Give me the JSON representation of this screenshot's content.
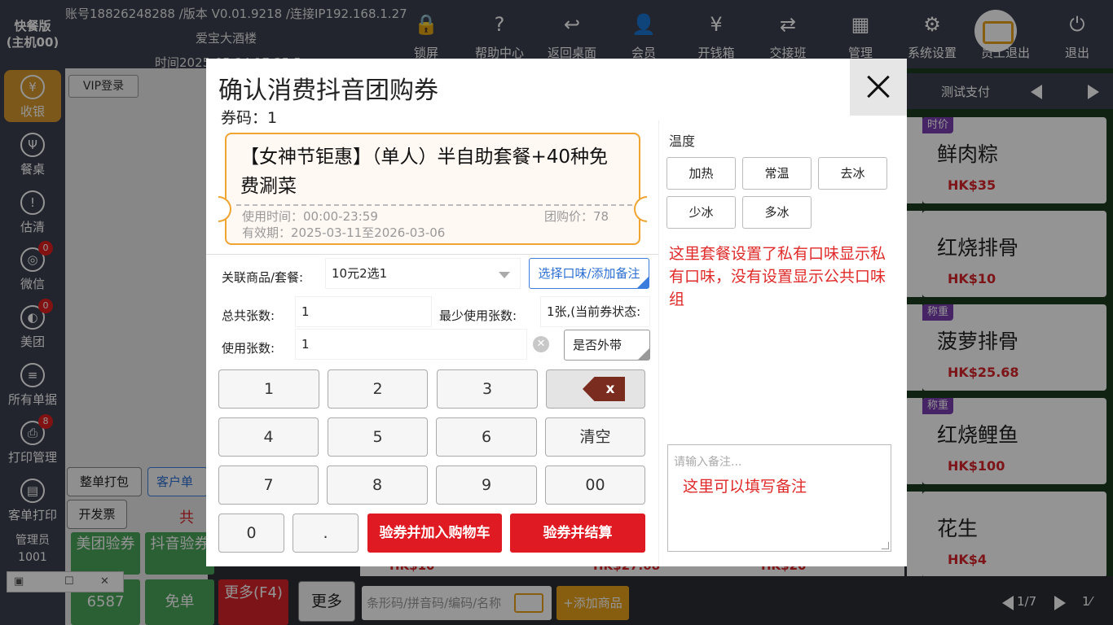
{
  "app": {
    "edition_line1": "快餐版",
    "edition_line2": "(主机00)",
    "account_info": "账号18826248288 /版本 V0.01.9218 /连接IP192.168.1.27",
    "restaurant": "爱宝大酒楼",
    "time_text": "时间2025-05-24 17:35:51"
  },
  "topbar": [
    {
      "label": "锁屏",
      "icon": "🔒"
    },
    {
      "label": "帮助中心",
      "icon": "?"
    },
    {
      "label": "返回桌面",
      "icon": "↩"
    },
    {
      "label": "会员",
      "icon": "👤"
    },
    {
      "label": "开钱箱",
      "icon": "¥"
    },
    {
      "label": "交接班",
      "icon": "⇄"
    },
    {
      "label": "管理",
      "icon": "▦"
    },
    {
      "label": "系统设置",
      "icon": "⚙"
    },
    {
      "label": "员工退出",
      "icon": ""
    },
    {
      "label": "退出",
      "icon": "⏻"
    }
  ],
  "sidebar": [
    {
      "label": "收银",
      "icon": "¥",
      "badge": ""
    },
    {
      "label": "餐桌",
      "icon": "Ψ",
      "badge": ""
    },
    {
      "label": "估清",
      "icon": "!",
      "badge": ""
    },
    {
      "label": "微信",
      "icon": "◎",
      "badge": "0"
    },
    {
      "label": "美团",
      "icon": "◐",
      "badge": "0"
    },
    {
      "label": "所有单据",
      "icon": "≡",
      "badge": ""
    },
    {
      "label": "打印管理",
      "icon": "⎙",
      "badge": "8"
    },
    {
      "label": "客单打印",
      "icon": "▤",
      "badge": ""
    }
  ],
  "admin": {
    "role": "管理员",
    "id": "1001"
  },
  "order_panel": {
    "vip_login": "VIP登录",
    "pack_all": "整单打包",
    "customer_order": "客户单",
    "invoice": "开发票",
    "total_prefix": "共",
    "meituan_verify": "美团验券",
    "douyin_verify": "抖音验券",
    "amount": "6587",
    "free_order": "免单",
    "more_f4": "更多(F4)",
    "more": "更多"
  },
  "right_panel": {
    "pay_label": "测试支付",
    "dishes": [
      {
        "tag": "时价",
        "name": "鲜肉粽",
        "price": "HK$35"
      },
      {
        "tag": "",
        "name": "红烧排骨",
        "price": "HK$10"
      },
      {
        "tag": "称重",
        "name": "菠萝排骨",
        "price": "HK$25.68"
      },
      {
        "tag": "称重",
        "name": "红烧鲤鱼",
        "price": "HK$100"
      },
      {
        "tag": "",
        "name": "花生",
        "price": "HK$4"
      }
    ],
    "bottom_prices": [
      "HK$10",
      "HK$27.68",
      "HK$20"
    ],
    "search_placeholder": "条形码/拼音码/编码/名称",
    "add_item": "+添加商品",
    "page": "1/7",
    "page_end": "1⁄"
  },
  "modal": {
    "title": "确认消费抖音团购券",
    "code_label": "券码：",
    "code_value": "1",
    "ticket": {
      "name": "【女神节钜惠】（单人）半自助套餐+40种免费涮菜",
      "use_time": "使用时间：00:00-23:59",
      "price": "团购价：78",
      "validity": "有效期：2025-03-11至2026-03-06"
    },
    "form": {
      "related_label": "关联商品/套餐:",
      "related_value": "10元2选1",
      "flavor_btn": "选择口味/添加备注",
      "total_label": "总共张数:",
      "total_value": "1",
      "min_label": "最少使用张数:",
      "min_value": "1张,(当前券状态:",
      "use_label": "使用张数:",
      "use_value": "1",
      "takeaway": "是否外带"
    },
    "keypad": [
      "1",
      "2",
      "3",
      "4",
      "5",
      "6",
      "清空",
      "7",
      "8",
      "9",
      "00",
      "0",
      "."
    ],
    "backspace": "x",
    "verify_add_cart": "验券并加入购物车",
    "verify_checkout": "验券并结算",
    "temperature": {
      "label": "温度",
      "options": [
        "加热",
        "常温",
        "去冰",
        "少冰",
        "多冰"
      ]
    },
    "annotation": "这里套餐设置了私有口味显示私有口味，没有设置显示公共口味组",
    "remark_placeholder": "请输入备注...",
    "remark_hint": "这里可以填写备注"
  },
  "colors": {
    "accent_orange": "#e9a21a",
    "sidebar_bg": "#3b4150",
    "verify_red": "#e01a22",
    "ticket_border": "#f0a431",
    "annotation_red": "#e02a2a"
  }
}
